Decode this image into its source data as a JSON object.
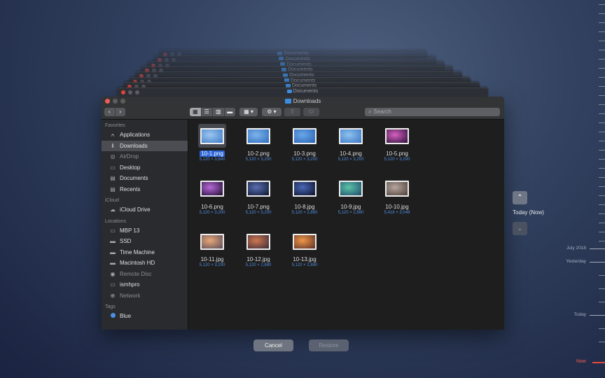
{
  "background_windows": [
    {
      "title": "Documents"
    },
    {
      "title": "Documents"
    },
    {
      "title": "Documents"
    },
    {
      "title": "Documents"
    },
    {
      "title": "Documents"
    },
    {
      "title": "Documents"
    },
    {
      "title": "Documents"
    },
    {
      "title": "Documents"
    }
  ],
  "window": {
    "title": "Downloads",
    "search_placeholder": "Search"
  },
  "sidebar": {
    "sections": [
      {
        "header": "Favorites",
        "items": [
          {
            "label": "Applications",
            "icon": "applications-icon"
          },
          {
            "label": "Downloads",
            "icon": "downloads-icon",
            "selected": true
          },
          {
            "label": "AirDrop",
            "icon": "airdrop-icon",
            "dim": true
          },
          {
            "label": "Desktop",
            "icon": "desktop-icon"
          },
          {
            "label": "Documents",
            "icon": "documents-icon"
          },
          {
            "label": "Recents",
            "icon": "recents-icon"
          }
        ]
      },
      {
        "header": "iCloud",
        "items": [
          {
            "label": "iCloud Drive",
            "icon": "cloud-icon"
          }
        ]
      },
      {
        "header": "Locations",
        "items": [
          {
            "label": "MBP 13",
            "icon": "laptop-icon"
          },
          {
            "label": "SSD",
            "icon": "disk-icon"
          },
          {
            "label": "Time Machine",
            "icon": "disk-icon"
          },
          {
            "label": "Macintosh HD",
            "icon": "disk-icon"
          },
          {
            "label": "Remote Disc",
            "icon": "disc-icon",
            "dim": true
          },
          {
            "label": "ismhpro",
            "icon": "monitor-icon"
          },
          {
            "label": "Network",
            "icon": "network-icon",
            "dim": true
          }
        ]
      },
      {
        "header": "Tags",
        "items": [
          {
            "label": "Blue",
            "icon": "tag-dot",
            "color": "#4a8fe2"
          }
        ]
      }
    ]
  },
  "files": [
    {
      "name": "10-1.png",
      "size": "5,120 × 3,840",
      "selected": true,
      "colors": [
        "#9ec6ef",
        "#3b7cc9"
      ]
    },
    {
      "name": "10-2.png",
      "size": "5,120 × 3,200",
      "colors": [
        "#7fb4ea",
        "#2d6cc0"
      ]
    },
    {
      "name": "10-3.png",
      "size": "5,120 × 3,200",
      "colors": [
        "#6aa8e8",
        "#2a61b5"
      ]
    },
    {
      "name": "10-4.png",
      "size": "5,120 × 3,200",
      "colors": [
        "#8fc2ee",
        "#3a76c5"
      ]
    },
    {
      "name": "10-5.png",
      "size": "5,120 × 3,200",
      "colors": [
        "#d85fc0",
        "#281038"
      ]
    },
    {
      "name": "10-6.png",
      "size": "5,120 × 3,200",
      "colors": [
        "#b868d8",
        "#1e0d33"
      ]
    },
    {
      "name": "10-7.png",
      "size": "5,120 × 3,200",
      "colors": [
        "#5a6fb0",
        "#0d1530"
      ]
    },
    {
      "name": "10-8.jpg",
      "size": "5,120 × 2,880",
      "colors": [
        "#4a68b8",
        "#0a1028"
      ]
    },
    {
      "name": "10-9.jpg",
      "size": "5,120 × 2,880",
      "colors": [
        "#5ec3a8",
        "#1a4a6a"
      ]
    },
    {
      "name": "10-10.jpg",
      "size": "5,418 × 3,048",
      "colors": [
        "#b8a6a0",
        "#4a4038"
      ]
    },
    {
      "name": "10-11.jpg",
      "size": "5,120 × 3,200",
      "colors": [
        "#e8a878",
        "#5a4a58"
      ]
    },
    {
      "name": "10-12.jpg",
      "size": "5,120 × 2,880",
      "colors": [
        "#d07850",
        "#3a2a3a"
      ]
    },
    {
      "name": "10-13.jpg",
      "size": "5,120 × 2,880",
      "colors": [
        "#f09848",
        "#5a2e28"
      ]
    }
  ],
  "buttons": {
    "cancel": "Cancel",
    "restore": "Restore"
  },
  "time_machine": {
    "current_label": "Today (Now)",
    "timeline_labels": [
      {
        "label": "July 2018"
      },
      {
        "label": "Yesterday"
      },
      {
        "label": "Today"
      },
      {
        "label": "Now",
        "now": true
      }
    ]
  },
  "colors": {
    "accent": "#2c65d8",
    "close": "#ec5f59",
    "now": "#ef5c4e"
  }
}
